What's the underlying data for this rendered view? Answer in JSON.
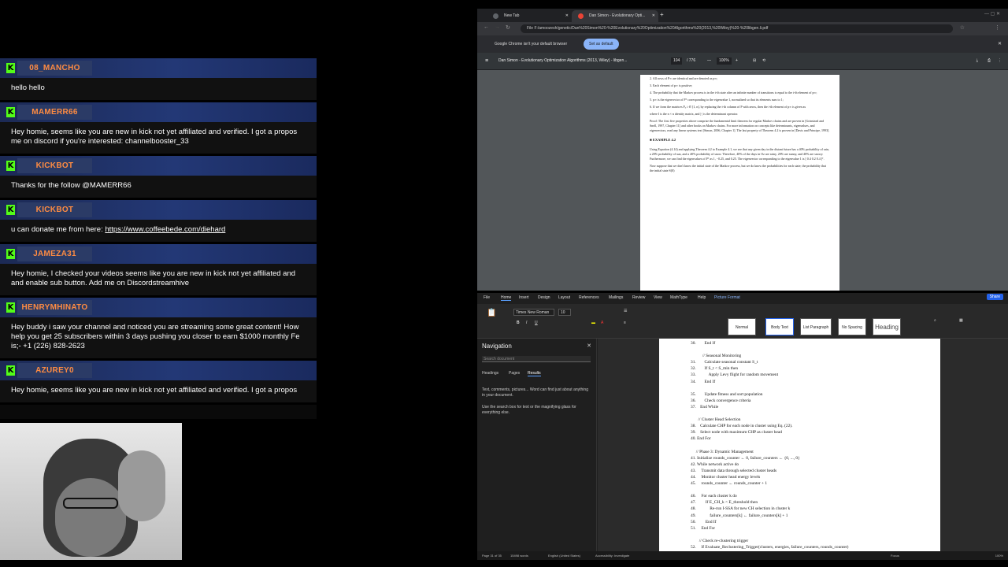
{
  "chat": {
    "messages": [
      {
        "user": "08_MANCHO",
        "text": "hello hello"
      },
      {
        "user": "MAMERR66",
        "text": "Hey homie, seems like you are new in kick not yet affiliated and verified. I got a propos\nme on discord if you're interested: channelbooster_33"
      },
      {
        "user": "KICKBOT",
        "text": "Thanks for the follow @MAMERR66"
      },
      {
        "user": "KICKBOT",
        "text": "u can donate me from here: ",
        "link": "https://www.coffeebede.com/diehard"
      },
      {
        "user": "JAMEZA31",
        "text": "Hey homie, I checked your videos seems like you are new in kick not yet affiliated and\nand enable sub button. Add me on Discordstreamhive"
      },
      {
        "user": "HENRYMHINATO",
        "text": "Hey buddy i saw your channel and noticed you are streaming some great content! How\nhelp you get 25 subscribers within 3 days pushing you closer to earn $1000 monthly Fe\nis;- +1 (226) 828-2623"
      },
      {
        "user": "AZUREY0",
        "text": "Hey homie, seems like you are new in kick not yet affiliated and verified. I got a propos"
      }
    ]
  },
  "chrome": {
    "tabs": [
      {
        "label": "New Tab"
      },
      {
        "label": "Dan Simon - Evolutionary Opti..."
      }
    ],
    "address": "File   F:/amoozesh/genetic/Dan%20Simon%20-%20Evolutionary%20Optimization%20Algorithms%20(2013,%20Wiley)%20-%20libgen.li.pdf",
    "infobar_text": "Google Chrome isn't your default browser",
    "infobar_button": "Set as default",
    "pdf_title": "Dan Simon - Evolutionary Optimization Algorithms (2013, Wiley) - libgen...",
    "page_current": "104",
    "page_total": "/ 776",
    "zoom": "100%",
    "pdf_lines": [
      "2. All rows of P∞ are identical and are denoted as p∞;",
      "3. Each element of p∞ is positive;",
      "4. The probability that the Markov process is in the i-th state after an infinite number of transitions is equal to the i-th element of p∞;",
      "5. p∞ is the eigenvector of Pᵀ corresponding to the eigenvalue 1, normalized so that its elements sum to 1;",
      "6. If we form the matrices Pᵢ, i ∈ [1, n], by replacing the i-th column of P with zeros, then the i-th element of p∞ is given as",
      "where I is the n × n identity matrix, and |·| is the determinant operator.",
      "Proof: The first five properties above comprise the fundamental limit theorem for regular Markov chains and are proven in [Grinstead and Snell, 1997, Chapter 11] and other books on Markov chains. For more information on concepts like determinants, eigenvalues, and eigenvectors, read any linear systems text [Simon, 2006, Chapter 1]. The last property of Theorem 4.2 is proven in [Davis and Principe, 1993].",
      "■ EXAMPLE 4.2",
      "Using Equation (4.14) and applying Theorem 4.2 to Example 4.1, we see that any given day in the distant future has a 40% probability of rain, a 20% probability of sun, and a 40% probability of snow. Therefore, 40% of the days in Oz are rainy, 20% are sunny, and 40% are snowy. Furthermore, we can find the eigenvalues of Pᵀ as 1, −0.25, and 0.25. The eigenvector corresponding to the eigenvalue 1 is [ 0.4  0.2  0.4 ]ᵀ.",
      "Now suppose that we don't know the initial state of the Markov process, but we do know the probabilities for each state; the probability that the initial state S(0)"
    ]
  },
  "word": {
    "tabs": [
      "File",
      "Home",
      "Insert",
      "Design",
      "Layout",
      "References",
      "Mailings",
      "Review",
      "View",
      "MathType",
      "Help",
      "Picture Format"
    ],
    "share": "Share",
    "font_name": "Times New Roman",
    "font_size": "10",
    "styles": [
      "Normal",
      "Body Text",
      "List Paragraph",
      "No Spacing",
      "Heading"
    ],
    "nav_title": "Navigation",
    "nav_search_placeholder": "Search document",
    "nav_tabs": [
      "Headings",
      "Pages",
      "Results"
    ],
    "nav_hint1": "Text, comments, pictures... Word can find just about anything in your document.",
    "nav_hint2": "Use the search box for text or the magnifying glass for everything else.",
    "doc_lines": [
      "30.        End If",
      "",
      "           // Seasonal Monitoring",
      "31.        Calculate seasonal constant S_t",
      "32.        If S_t < S_min then",
      "33.            Apply Levy flight for random movement",
      "34.        End If",
      "",
      "35.        Update fitness and sort population",
      "36.        Check convergence criteria",
      "37.    End While",
      "",
      "       // Cluster Head Selection",
      "38.    Calculate CHP for each node in cluster using Eq. (22).",
      "39.    Select node with maximum CHP as cluster head",
      "40. End For",
      "",
      "     // Phase 3: Dynamic Management",
      "41. Initialize rounds_counter ← 0, failure_counters ← {0, ..., 0}",
      "42. While network active do",
      "43.     Transmit data through selected cluster heads",
      "44.     Monitor cluster head energy levels",
      "45.     rounds_counter ← rounds_counter + 1",
      "",
      "46.     For each cluster k do",
      "47.         If E_CH_k < E_threshold then",
      "48.             Re-run I-SSA for new CH selection in cluster k",
      "49.             failure_counters[k] ← failure_counters[k] + 1",
      "50.         End If",
      "51.     End For",
      "",
      "        // Check re-clustering trigger",
      "52.     If Evaluate_Reclustering_Trigger(clusters, energies, failure_counters, rounds_counter)"
    ],
    "status_page": "Page 31 of 35",
    "status_words": "15498 words",
    "status_lang": "English (United States)",
    "status_access": "Accessibility: Investigate",
    "status_focus": "Focus",
    "status_zoom": "100%"
  }
}
